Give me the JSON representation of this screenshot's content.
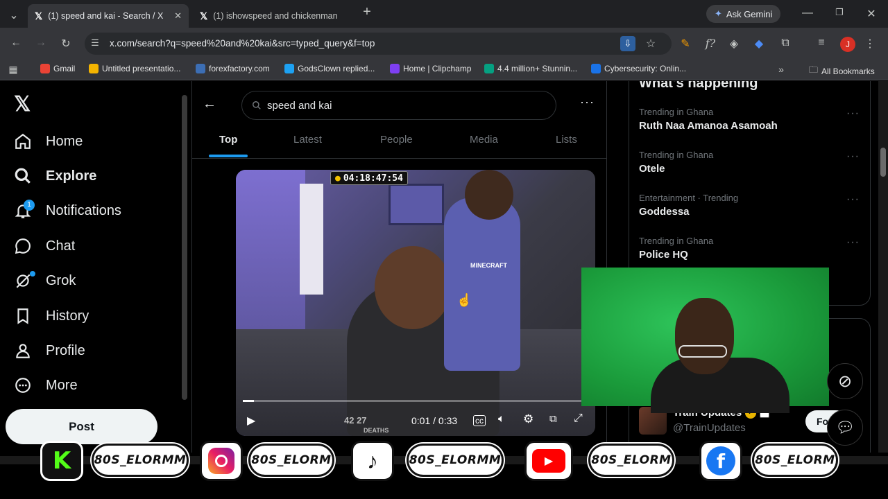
{
  "browser": {
    "tabs": [
      {
        "title": "(1) speed and kai - Search / X",
        "active": true
      },
      {
        "title": "(1) ishowspeed and chickenman",
        "active": false
      }
    ],
    "new_tab": "+",
    "ask_gemini": "Ask Gemini",
    "url": "x.com/search?q=speed%20and%20kai&src=typed_query&f=top",
    "profile_initial": "J",
    "bookmarks": [
      {
        "label": "Gmail",
        "color": "#ea4335"
      },
      {
        "label": "Untitled presentatio...",
        "color": "#f4b400"
      },
      {
        "label": "forexfactory.com",
        "color": "#3c6eb4"
      },
      {
        "label": "GodsClown replied...",
        "color": "#1da1f2"
      },
      {
        "label": "Home | Clipchamp",
        "color": "#7e3ff2"
      },
      {
        "label": "4.4 million+ Stunnin...",
        "color": "#05a081"
      },
      {
        "label": "Cybersecurity: Onlin...",
        "color": "#1a73e8"
      }
    ],
    "all_bookmarks": "All Bookmarks"
  },
  "x": {
    "nav": [
      {
        "label": "Home",
        "icon": "home-icon"
      },
      {
        "label": "Explore",
        "icon": "search-icon"
      },
      {
        "label": "Notifications",
        "icon": "bell-icon",
        "badge": "1"
      },
      {
        "label": "Chat",
        "icon": "chat-icon"
      },
      {
        "label": "Grok",
        "icon": "grok-icon"
      },
      {
        "label": "History",
        "icon": "bookmark-icon"
      },
      {
        "label": "Profile",
        "icon": "person-icon"
      },
      {
        "label": "More",
        "icon": "more-icon"
      }
    ],
    "post_button": "Post",
    "search_value": "speed and kai",
    "tabs": [
      "Top",
      "Latest",
      "People",
      "Media",
      "Lists"
    ],
    "video": {
      "timer": "04:18:47:54",
      "time": "0:01 / 0:33",
      "hud": "42  27",
      "hud_label": "DEATHS",
      "shirt_text": "MINECRAFT"
    },
    "whats_happening": "What's happening",
    "trends": [
      {
        "meta": "Trending in Ghana",
        "name": "Ruth Naa Amanoa Asamoah"
      },
      {
        "meta": "Trending in Ghana",
        "name": "Otele"
      },
      {
        "meta": "Entertainment · Trending",
        "name": "Goddessa"
      },
      {
        "meta": "Trending in Ghana",
        "name": "Police HQ"
      }
    ],
    "who_to_follow": {
      "name": "Train Updates",
      "handle": "@TrainUpdates",
      "follow": "Fo"
    }
  },
  "overlay": {
    "handles": [
      "80S_ELORMM",
      "80S_ELORM",
      "80S_ELORMM",
      "80S_ELORM",
      "80S_ELORM"
    ],
    "colors": {
      "kick": "#53fc18",
      "youtube": "#ff0000",
      "facebook": "#1877f2",
      "greenscreen": "#1a9a3a"
    }
  }
}
